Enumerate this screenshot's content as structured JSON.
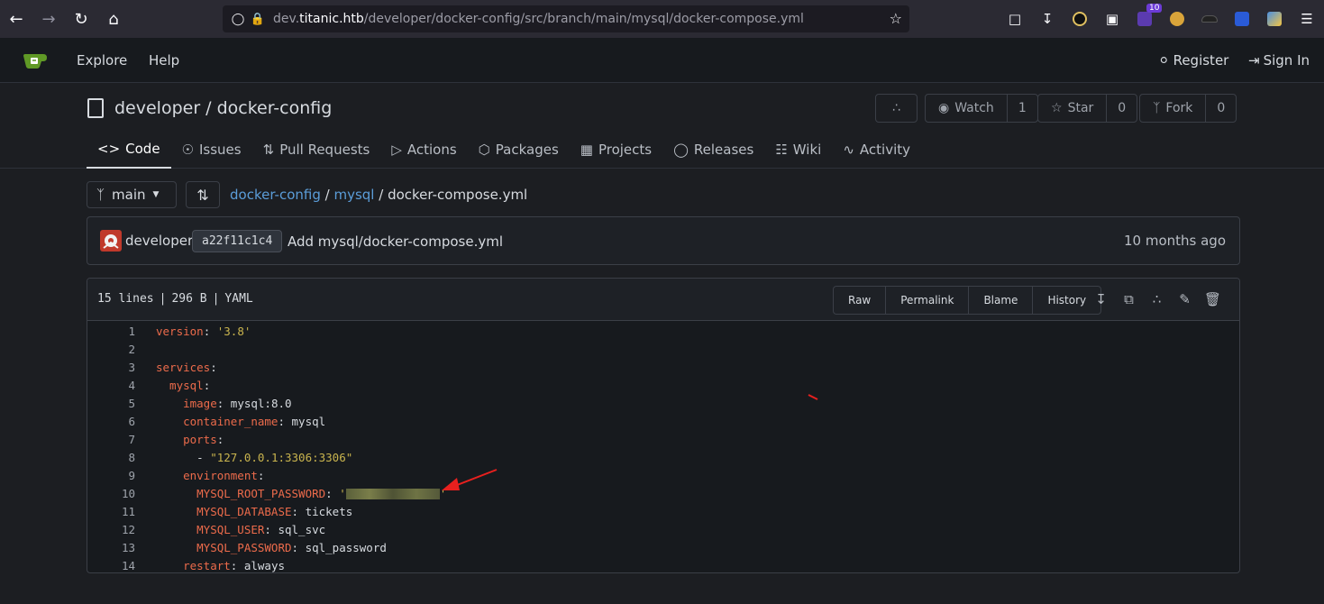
{
  "browser": {
    "url_prefix": "dev.",
    "url_domain": "titanic.htb",
    "url_path": "/developer/docker-config/src/branch/main/mysql/docker-compose.yml",
    "ext_badge": "10"
  },
  "nav": {
    "explore": "Explore",
    "help": "Help",
    "register": "Register",
    "sign_in": "Sign In"
  },
  "repo": {
    "owner": "developer",
    "name": "docker-config",
    "watch_label": "Watch",
    "watch_count": "1",
    "star_label": "Star",
    "star_count": "0",
    "fork_label": "Fork",
    "fork_count": "0"
  },
  "tabs": {
    "code": "Code",
    "issues": "Issues",
    "pull_requests": "Pull Requests",
    "actions": "Actions",
    "packages": "Packages",
    "projects": "Projects",
    "releases": "Releases",
    "wiki": "Wiki",
    "activity": "Activity"
  },
  "breadcrumb": {
    "branch": "main",
    "repo": "docker-config",
    "folder": "mysql",
    "file": "docker-compose.yml"
  },
  "commit": {
    "author": "developer",
    "sha": "a22f11c1c4",
    "message": "Add mysql/docker-compose.yml",
    "time": "10 months ago"
  },
  "file": {
    "lines": "15 lines",
    "size": "296 B",
    "lang": "YAML",
    "raw": "Raw",
    "permalink": "Permalink",
    "blame": "Blame",
    "history": "History"
  },
  "code_lines": [
    {
      "n": "1",
      "key": "version",
      "sep": ": ",
      "val": "'3.8'",
      "val_type": "string"
    },
    {
      "n": "2",
      "key": "",
      "sep": "",
      "val": "",
      "val_type": "plain"
    },
    {
      "n": "3",
      "key": "services",
      "sep": ":",
      "val": "",
      "val_type": "plain"
    },
    {
      "n": "4",
      "key": "  mysql",
      "sep": ":",
      "val": "",
      "val_type": "plain"
    },
    {
      "n": "5",
      "key": "    image",
      "sep": ": ",
      "val": "mysql:8.0",
      "val_type": "plain"
    },
    {
      "n": "6",
      "key": "    container_name",
      "sep": ": ",
      "val": "mysql",
      "val_type": "plain"
    },
    {
      "n": "7",
      "key": "    ports",
      "sep": ":",
      "val": "",
      "val_type": "plain"
    },
    {
      "n": "8",
      "key": "",
      "sep": "      - ",
      "val": "\"127.0.0.1:3306:3306\"",
      "val_type": "string"
    },
    {
      "n": "9",
      "key": "    environment",
      "sep": ":",
      "val": "",
      "val_type": "plain"
    },
    {
      "n": "10",
      "key": "      MYSQL_ROOT_PASSWORD",
      "sep": ": ",
      "val": "",
      "val_type": "redacted"
    },
    {
      "n": "11",
      "key": "      MYSQL_DATABASE",
      "sep": ": ",
      "val": "tickets",
      "val_type": "plain"
    },
    {
      "n": "12",
      "key": "      MYSQL_USER",
      "sep": ": ",
      "val": "sql_svc",
      "val_type": "plain"
    },
    {
      "n": "13",
      "key": "      MYSQL_PASSWORD",
      "sep": ": ",
      "val": "sql_password",
      "val_type": "plain"
    },
    {
      "n": "14",
      "key": "    restart",
      "sep": ": ",
      "val": "always",
      "val_type": "plain"
    }
  ],
  "colors": {
    "accent_link": "#5b9dd9",
    "yaml_key": "#ec6b4b",
    "yaml_string": "#c9b44e",
    "annotation_arrow": "#e8201e"
  }
}
